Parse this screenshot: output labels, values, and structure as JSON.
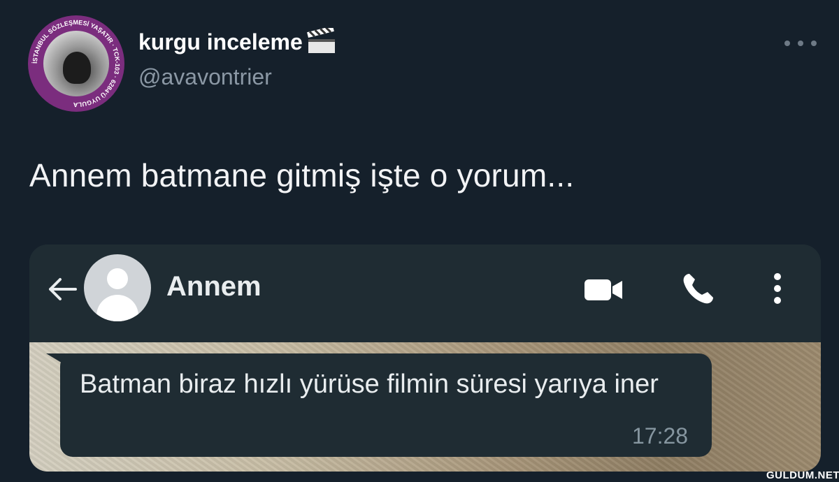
{
  "tweet": {
    "author": {
      "name": "kurgu inceleme",
      "handle": "@avavontrier",
      "avatar_badge_text": "İSTANBUL SÖZLEŞMESİ YAŞATIR · TCK-103 · 6284'Ü UYGULA"
    },
    "text": "Annem batmane gitmiş işte o yorum..."
  },
  "whatsapp": {
    "contact_name": "Annem",
    "message": {
      "text": "Batman biraz hızlı yürüse filmin süresi yarıya iner",
      "time": "17:28"
    }
  },
  "watermark": "GULDUM.NET",
  "icons": [
    "more-icon",
    "back-arrow-icon",
    "video-call-icon",
    "phone-icon",
    "menu-icon",
    "clapperboard-icon"
  ],
  "colors": {
    "background": "#15202b",
    "handle": "#8b98a5",
    "whatsapp_header": "#1f2c33",
    "avatar_ring": "#7b2d7e"
  }
}
